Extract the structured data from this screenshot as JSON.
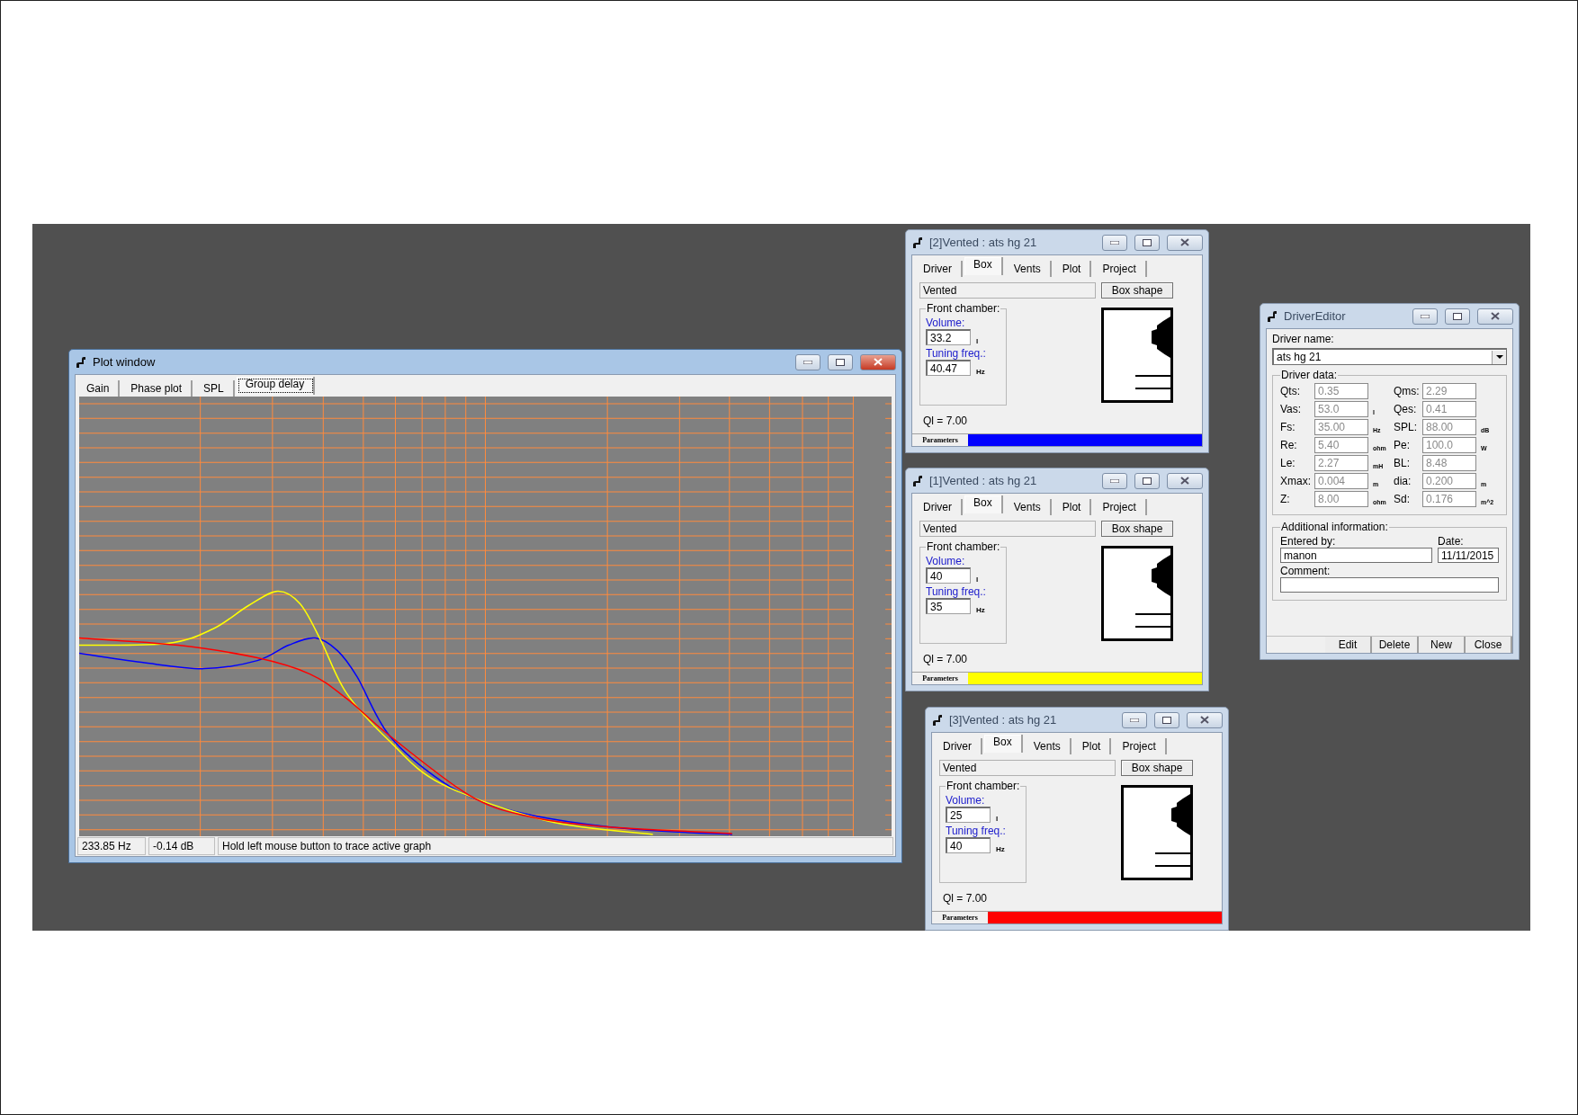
{
  "plot_window": {
    "title": "Plot window",
    "active": true,
    "tabs": [
      {
        "label": "Gain",
        "selected": false
      },
      {
        "label": "Phase plot",
        "selected": false
      },
      {
        "label": "SPL",
        "selected": false
      },
      {
        "label": "Group delay",
        "selected": true
      }
    ],
    "status_bar": [
      "233.85 Hz",
      "-0.14 dB",
      "Hold left mouse button to trace active graph"
    ]
  },
  "vented_windows": [
    {
      "title": "[2]Vented : ats hg 21",
      "active": false,
      "tabs": [
        {
          "label": "Driver",
          "selected": false
        },
        {
          "label": "Box",
          "selected": true
        },
        {
          "label": "Vents",
          "selected": false
        },
        {
          "label": "Plot",
          "selected": false
        },
        {
          "label": "Project",
          "selected": false
        }
      ],
      "box_type": "Vented",
      "box_shape_button": "Box shape",
      "group_label": "Front chamber:",
      "volume_label": "Volume:",
      "volume": "33.2",
      "volume_unit": "l",
      "tuning_label": "Tuning freq.:",
      "tuning": "40.47",
      "tuning_unit": "Hz",
      "ql": "Ql = 7.00",
      "parameters_label": "Parameters",
      "color": "#0000ff"
    },
    {
      "title": "[1]Vented : ats hg 21",
      "active": false,
      "tabs": [
        {
          "label": "Driver",
          "selected": false
        },
        {
          "label": "Box",
          "selected": true
        },
        {
          "label": "Vents",
          "selected": false
        },
        {
          "label": "Plot",
          "selected": false
        },
        {
          "label": "Project",
          "selected": false
        }
      ],
      "box_type": "Vented",
      "box_shape_button": "Box shape",
      "group_label": "Front chamber:",
      "volume_label": "Volume:",
      "volume": "40",
      "volume_unit": "l",
      "tuning_label": "Tuning freq.:",
      "tuning": "35",
      "tuning_unit": "Hz",
      "ql": "Ql = 7.00",
      "parameters_label": "Parameters",
      "color": "#ffff00"
    },
    {
      "title": "[3]Vented : ats hg 21",
      "active": false,
      "tabs": [
        {
          "label": "Driver",
          "selected": false
        },
        {
          "label": "Box",
          "selected": true
        },
        {
          "label": "Vents",
          "selected": false
        },
        {
          "label": "Plot",
          "selected": false
        },
        {
          "label": "Project",
          "selected": false
        }
      ],
      "box_type": "Vented",
      "box_shape_button": "Box shape",
      "group_label": "Front chamber:",
      "volume_label": "Volume:",
      "volume": "25",
      "volume_unit": "l",
      "tuning_label": "Tuning freq.:",
      "tuning": "40",
      "tuning_unit": "Hz",
      "ql": "Ql = 7.00",
      "parameters_label": "Parameters",
      "color": "#ff0000"
    }
  ],
  "driver_editor": {
    "title": "DriverEditor",
    "active": false,
    "driver_name_label": "Driver name:",
    "driver_name": "ats hg 21",
    "driver_data_label": "Driver data:",
    "driver_data": [
      [
        {
          "label": "Qts:",
          "value": "0.35",
          "disabled": true
        },
        {
          "label": "Qms:",
          "value": "2.29",
          "disabled": true
        }
      ],
      [
        {
          "label": "Vas:",
          "value": "53.0",
          "unit": "l",
          "disabled": true
        },
        {
          "label": "Qes:",
          "value": "0.41",
          "disabled": true
        }
      ],
      [
        {
          "label": "Fs:",
          "value": "35.00",
          "unit": "Hz",
          "disabled": true
        },
        {
          "label": "SPL:",
          "value": "88.00",
          "unit": "dB",
          "disabled": true
        }
      ],
      [
        {
          "label": "Re:",
          "value": "5.40",
          "unit": "ohm",
          "disabled": true
        },
        {
          "label": "Pe:",
          "value": "100.0",
          "unit": "W",
          "disabled": true
        }
      ],
      [
        {
          "label": "Le:",
          "value": "2.27",
          "unit": "mH",
          "disabled": true
        },
        {
          "label": "BL:",
          "value": "8.48",
          "disabled": true
        }
      ],
      [
        {
          "label": "Xmax:",
          "value": "0.004",
          "unit": "m",
          "disabled": true
        },
        {
          "label": "dia:",
          "value": "0.200",
          "unit": "m",
          "disabled": true
        }
      ],
      [
        {
          "label": "Z:",
          "value": "8.00",
          "unit": "ohm",
          "disabled": true
        },
        {
          "label": "Sd:",
          "value": "0.176",
          "unit": "m^2",
          "disabled": true
        }
      ]
    ],
    "additional_label": "Additional information:",
    "entered_by_label": "Entered by:",
    "entered_by": "manon",
    "date_label": "Date:",
    "date": "11/11/2015",
    "comment_label": "Comment:",
    "buttons": [
      "Edit",
      "Delete",
      "New",
      "Close"
    ]
  }
}
